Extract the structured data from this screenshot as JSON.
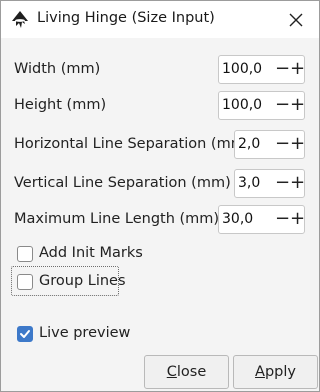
{
  "window": {
    "title": "Living Hinge (Size Input)"
  },
  "fields": [
    {
      "label": "Width (mm)",
      "value": "100,0"
    },
    {
      "label": "Height (mm)",
      "value": "100,0"
    },
    {
      "label": "Horizontal Line Separation (mm)",
      "value": "2,0"
    },
    {
      "label": "Vertical Line Separation (mm)",
      "value": "3,0"
    },
    {
      "label": "Maximum Line Length (mm)",
      "value": "30,0"
    }
  ],
  "spin_buttons": {
    "minus": "−",
    "plus": "+"
  },
  "checkboxes": {
    "add_init_marks": {
      "label": "Add Init Marks",
      "checked": false
    },
    "group_lines": {
      "label": "Group Lines",
      "checked": false
    },
    "live_preview": {
      "label": "Live preview",
      "checked": true
    }
  },
  "buttons": {
    "close": {
      "mnemonic": "C",
      "rest": "lose"
    },
    "apply": {
      "mnemonic": "A",
      "rest": "pply"
    }
  },
  "colors": {
    "accent": "#3d79c9"
  }
}
